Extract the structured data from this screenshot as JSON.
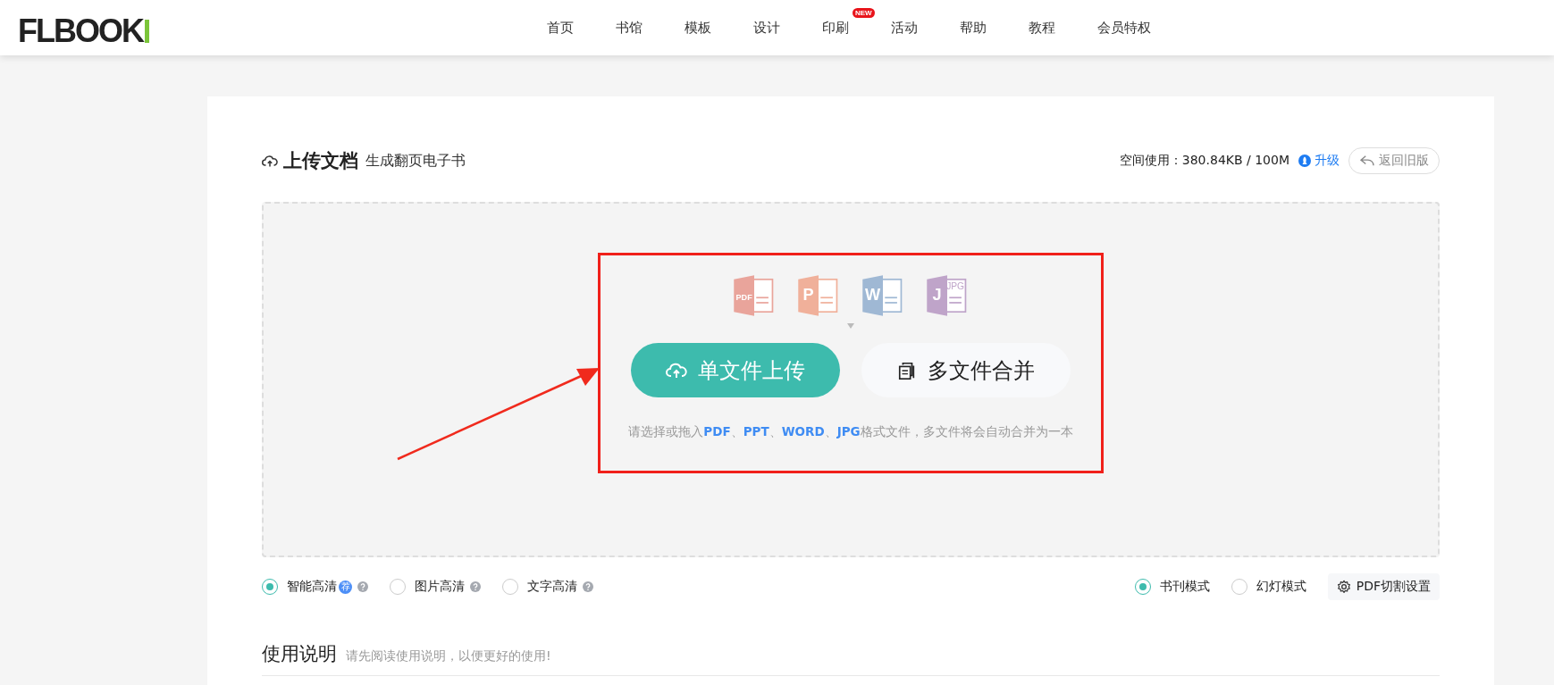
{
  "header": {
    "logo": "FLBOOK",
    "nav": [
      {
        "label": "首页"
      },
      {
        "label": "书馆"
      },
      {
        "label": "模板"
      },
      {
        "label": "设计"
      },
      {
        "label": "印刷",
        "badge": "NEW"
      },
      {
        "label": "活动"
      },
      {
        "label": "帮助"
      },
      {
        "label": "教程"
      },
      {
        "label": "会员特权"
      }
    ]
  },
  "upload": {
    "title": "上传文档",
    "subtitle": "生成翻页电子书",
    "usage_label": "空间使用：380.84KB / 100M",
    "upgrade": "升级",
    "back_button": "返回旧版",
    "file_icons": [
      {
        "letter": "PDF",
        "color": "#e9a49b"
      },
      {
        "letter": "P",
        "color": "#f0b09a"
      },
      {
        "letter": "W",
        "color": "#9fb8d4"
      },
      {
        "letter": "J",
        "sublabel": "JPG",
        "color": "#bfa4c9"
      }
    ],
    "single_button": "单文件上传",
    "multi_button": "多文件合并",
    "hint": "请选择或拖入**PDF**、**PPT**、**WORD**、**JPG**格式文件，多文件将会自动合并为一本"
  },
  "quality_options": [
    {
      "label": "智能高清",
      "badge": "荐",
      "selected": true
    },
    {
      "label": "图片高清",
      "selected": false
    },
    {
      "label": "文字高清",
      "selected": false
    }
  ],
  "mode_options": [
    {
      "label": "书刊模式",
      "selected": true
    },
    {
      "label": "幻灯模式",
      "selected": false
    }
  ],
  "settings_button": "PDF切割设置",
  "instructions": {
    "title": "使用说明",
    "subtitle": "请先阅读使用说明，以便更好的使用!"
  }
}
